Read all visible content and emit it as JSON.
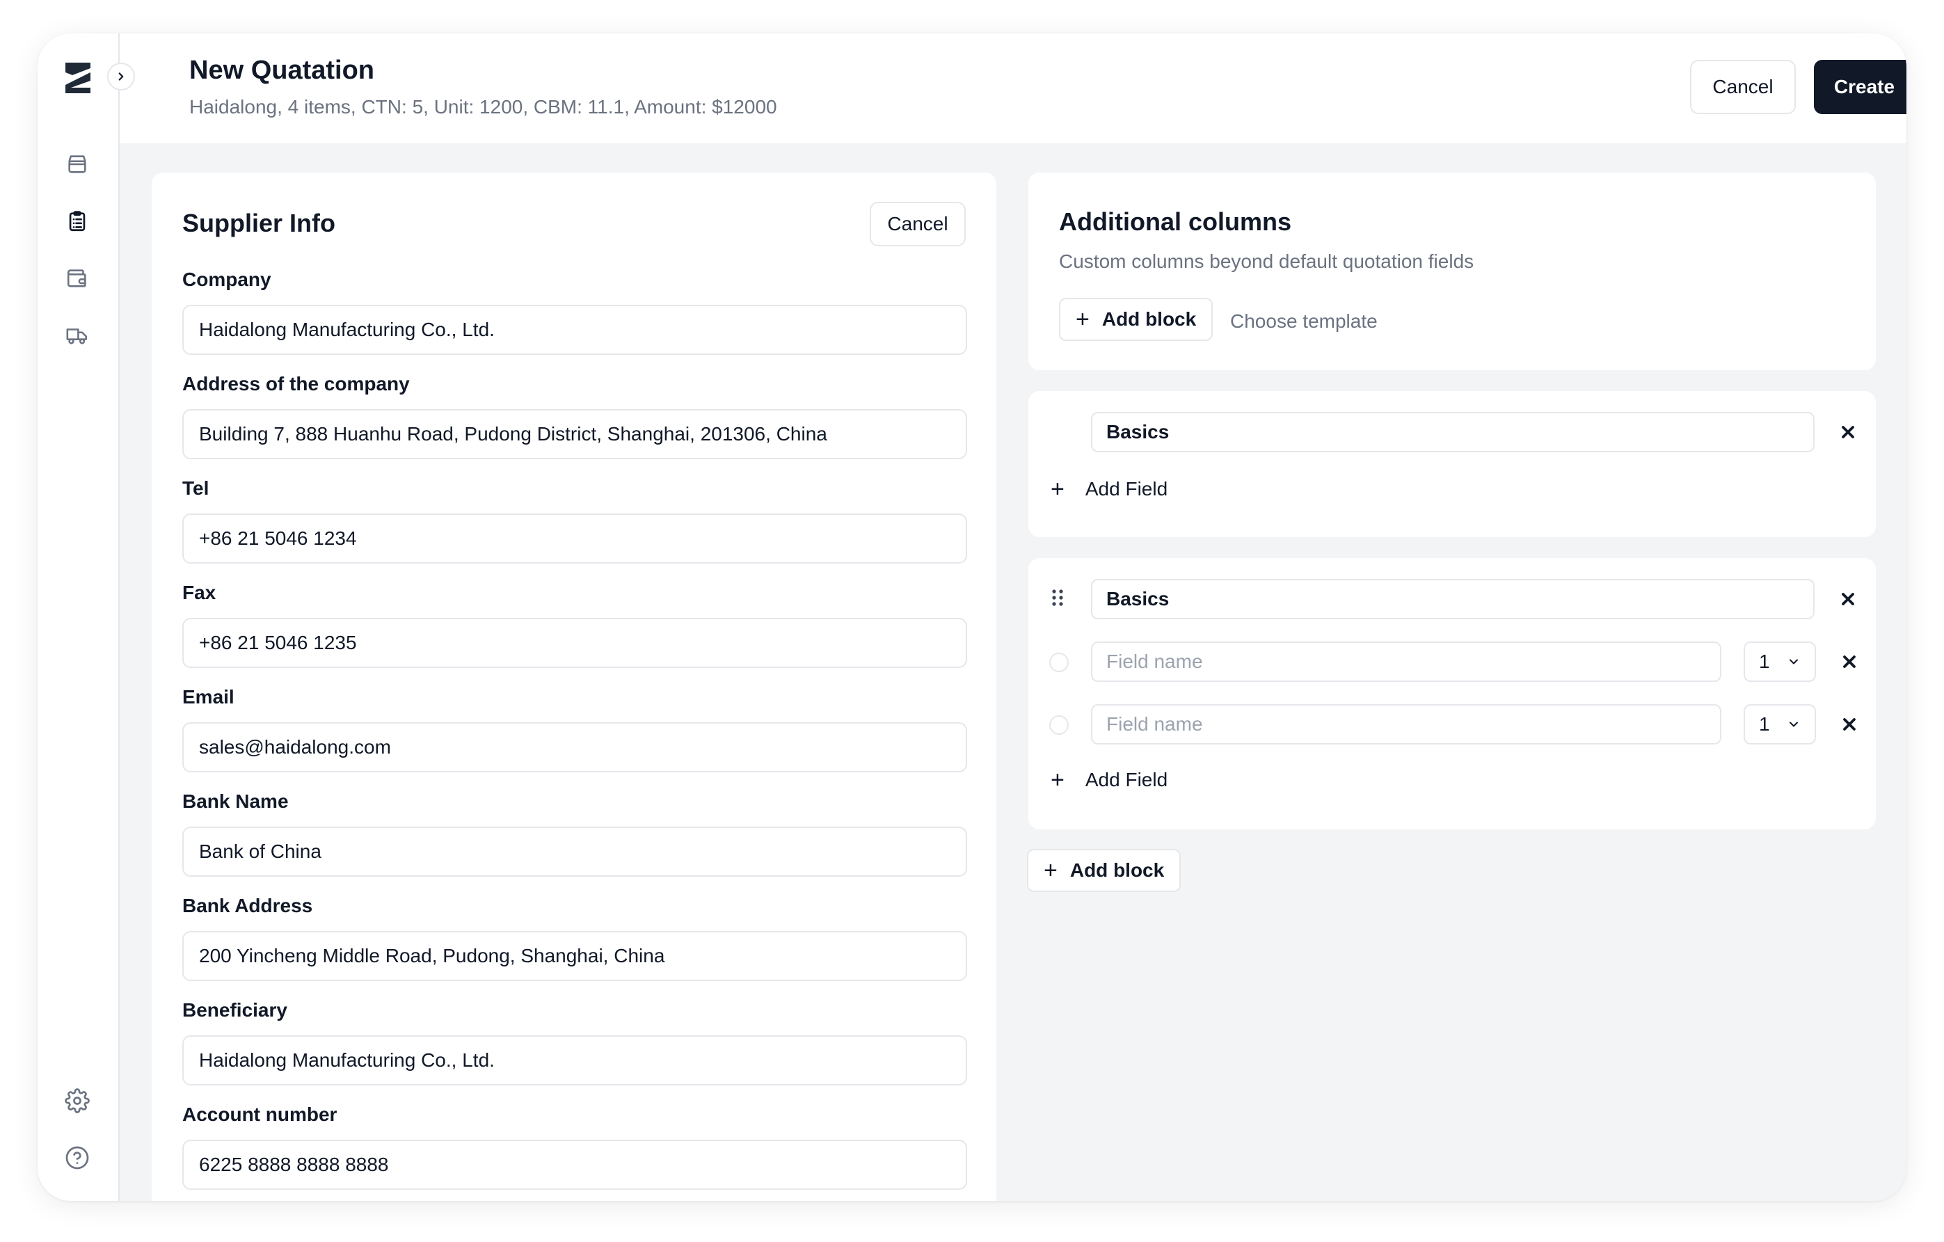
{
  "header": {
    "title": "New Quatation",
    "subtitle": "Haidalong, 4 items, CTN: 5, Unit: 1200, CBM: 11.1, Amount: $12000",
    "cancel_label": "Cancel",
    "create_label": "Create"
  },
  "sidebar": {
    "icons": [
      "logo-icon",
      "store-icon",
      "clipboard-list-icon",
      "wallet-icon",
      "truck-icon",
      "gear-icon",
      "help-icon"
    ]
  },
  "supplier": {
    "title": "Supplier Info",
    "cancel_label": "Cancel",
    "fields": [
      {
        "label": "Company",
        "value": "Haidalong Manufacturing Co., Ltd."
      },
      {
        "label": "Address of the company",
        "value": "Building 7, 888 Huanhu Road, Pudong District, Shanghai, 201306, China"
      },
      {
        "label": "Tel",
        "value": "+86 21 5046 1234"
      },
      {
        "label": "Fax",
        "value": "+86 21 5046 1235"
      },
      {
        "label": "Email",
        "value": "sales@haidalong.com"
      },
      {
        "label": "Bank Name",
        "value": "Bank of China"
      },
      {
        "label": "Bank Address",
        "value": "200 Yincheng Middle Road, Pudong, Shanghai, China"
      },
      {
        "label": "Beneficiary",
        "value": "Haidalong Manufacturing Co., Ltd."
      },
      {
        "label": "Account number",
        "value": "6225 8888 8888 8888"
      }
    ]
  },
  "additional": {
    "title": "Additional columns",
    "description": "Custom columns beyond default quotation fields",
    "add_block_label": "Add block",
    "choose_template_label": "Choose template"
  },
  "blocks": [
    {
      "name": "Basics",
      "add_field_label": "Add Field"
    },
    {
      "name": "Basics",
      "add_field_label": "Add Field",
      "fields": [
        {
          "placeholder": "Field name",
          "width": "1"
        },
        {
          "placeholder": "Field name",
          "width": "1"
        }
      ]
    }
  ],
  "bottom_add_block_label": "Add block"
}
